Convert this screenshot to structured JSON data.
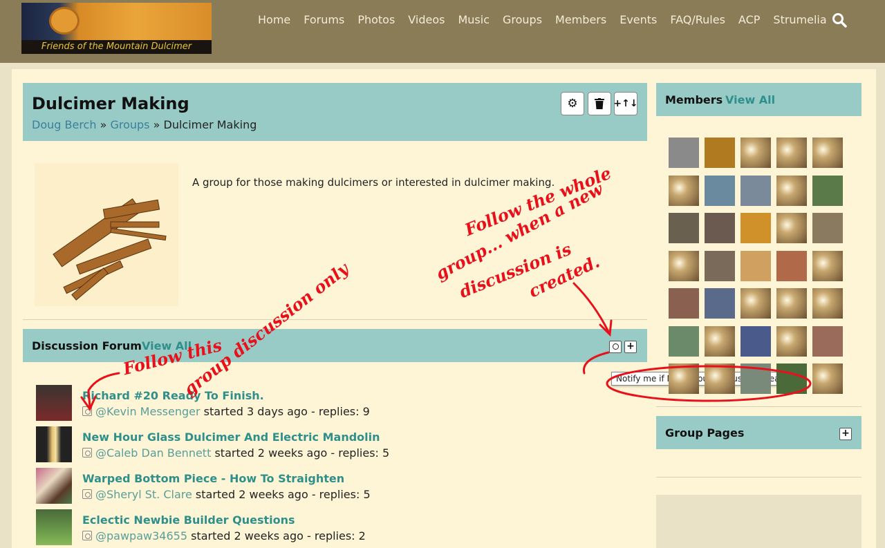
{
  "header": {
    "logo_text": "Friends of the Mountain Dulcimer",
    "nav": [
      "Home",
      "Forums",
      "Photos",
      "Videos",
      "Music",
      "Groups",
      "Members",
      "Events",
      "FAQ/Rules",
      "ACP",
      "Strumelia"
    ]
  },
  "group": {
    "title": "Dulcimer Making",
    "breadcrumb": [
      "Doug Berch",
      "Groups",
      "Dulcimer Making"
    ],
    "sep": "»",
    "description": "A group for those making dulcimers or interested in dulcimer making."
  },
  "forum": {
    "title": "Discussion Forum",
    "view_all": "View All",
    "tooltip": "Notify me if NEW group discussion created",
    "discussions": [
      {
        "title": "Richard #20 Ready To Finish.",
        "author": "@Kevin Messenger",
        "meta": "started 3 days ago - replies: 9"
      },
      {
        "title": "New Hour Glass Dulcimer And Electric Mandolin",
        "author": "@Caleb Dan Bennett",
        "meta": "started 2 weeks ago - replies: 5"
      },
      {
        "title": "Warped Bottom Piece - How To Straighten",
        "author": "@Sheryl St. Clare",
        "meta": "started 2 weeks ago - replies: 5"
      },
      {
        "title": "Eclectic Newbie Builder Questions",
        "author": "@pawpaw34655",
        "meta": "started 2 weeks ago - replies: 2"
      }
    ]
  },
  "members": {
    "title": "Members",
    "view_all": "View All"
  },
  "group_pages": {
    "title": "Group Pages"
  },
  "annotations": {
    "left": [
      "Follow this",
      "group discussion only"
    ],
    "right": [
      "Follow the whole",
      "group... when a new",
      "discussion is",
      "created."
    ]
  }
}
